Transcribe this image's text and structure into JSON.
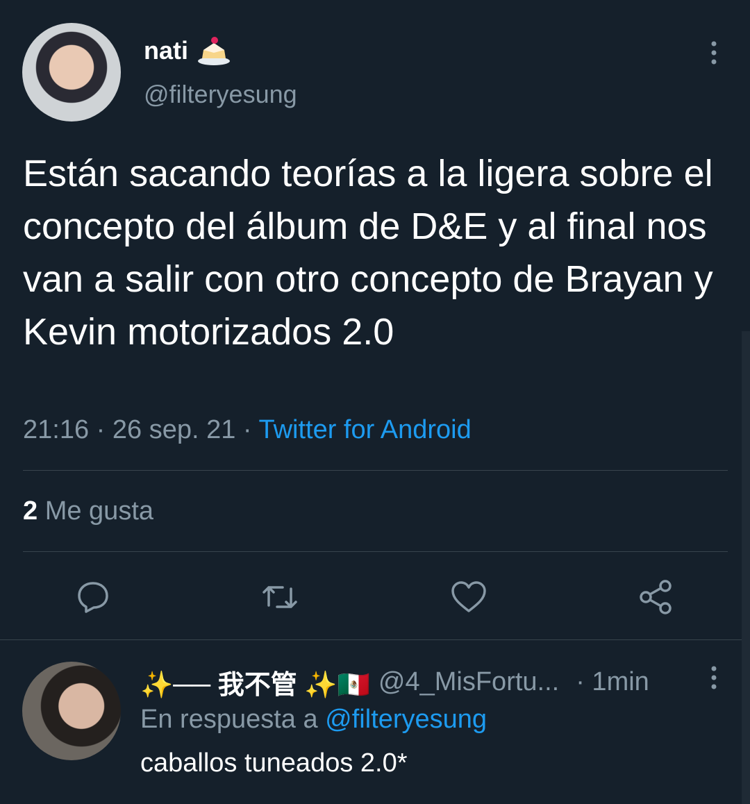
{
  "tweet": {
    "author_name": "nati",
    "author_handle": "@filteryesung",
    "text": "Están sacando teorías a la ligera sobre el concepto del álbum de D&E y al final nos van a salir con otro concepto de Brayan y Kevin motorizados 2.0",
    "time": "21:16",
    "date": "26 sep. 21",
    "source": "Twitter for Android",
    "likes_count": "2",
    "likes_label": "Me gusta"
  },
  "actions": [
    "reply-icon",
    "retweet-icon",
    "like-icon",
    "share-icon"
  ],
  "reply": {
    "name": "✨── 我不管 ✨🇲🇽",
    "handle": "@4_MisFortu...",
    "time": "· 1min",
    "reply_to_prefix": "En respuesta a",
    "reply_to_handle": "@filteryesung",
    "text": "caballos tuneados 2.0*"
  },
  "colors": {
    "background": "#15202b",
    "text": "#ffffff",
    "secondary": "#8899a6",
    "link": "#1d9bf0",
    "divider": "#38444d"
  }
}
